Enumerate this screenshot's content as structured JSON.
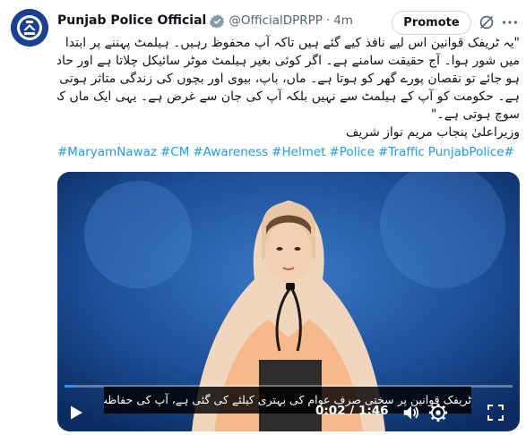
{
  "account": {
    "name": "Punjab Police Official",
    "handle": "@OfficialDPRPP",
    "separator": "·",
    "time": "4m",
    "verified_icon": "verified-badge-icon",
    "avatar_icon": "punjab-police-logo"
  },
  "actions": {
    "promote_label": "Promote",
    "grok_icon": "grok-icon",
    "more_icon": "more-icon"
  },
  "post": {
    "lines": [
      "\"یہ ٹریفک قوانین اس لیے نافذ کیے گئے ہیں تاکہ آپ محفوظ رہیں۔ ہیلمٹ پہننے پر ابتدا",
      "میں شور ہوا۔ آج حقیقت سامنے ہے۔ اگر کوئی بغیر ہیلمٹ موٹر سائیکل چلاتا ہے اور حادثہ",
      "ہو جائے تو نقصان پورے گھر کو ہوتا ہے۔ ماں، باپ، بیوی اور بچوں کی زندگی متاثر ہوتی",
      "ہے۔ حکومت کو آپ کے ہیلمٹ سے نہیں بلکہ آپ کی جان سے غرض ہے۔ یہی ایک ماں کی",
      "سوچ ہوتی ہے۔\"",
      "وزیراعلیٰ پنجاب مریم نواز شریف"
    ],
    "hashtags": [
      "#MaryamNawaz",
      "#CM",
      "#Awareness",
      "#Helmet",
      "#Police",
      "#Traffic",
      "PunjabPolice#"
    ]
  },
  "video": {
    "subtitle": "ٹریفک قوانین پر سختی صرف عوام کی بہتری کیلئے کی گئی ہے، آپ کی حفاظت ہماری ذمہ داری ہے",
    "current_time": "0:02",
    "duration": "1:46",
    "time_separator": " / ",
    "progress_fraction": 0.02,
    "accent_color": "#1d9bf0",
    "play_icon": "play-icon",
    "volume_icon": "volume-icon",
    "settings_icon": "settings-icon",
    "expand_icon": "expand-icon"
  }
}
